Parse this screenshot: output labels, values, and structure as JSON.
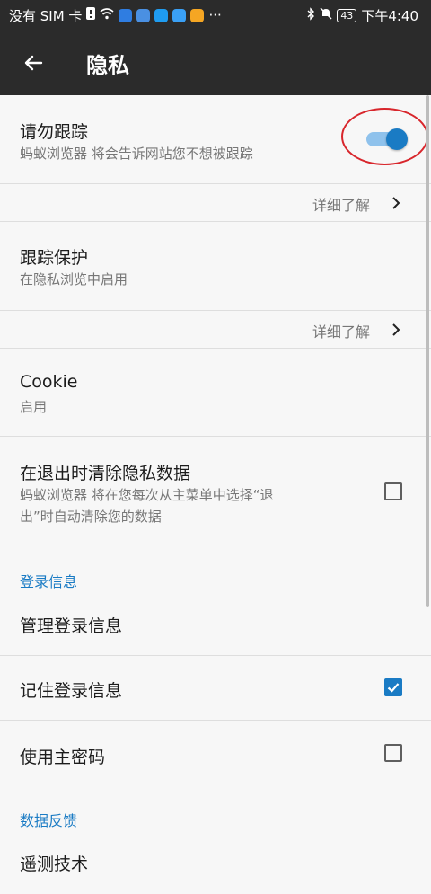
{
  "status": {
    "left_text": "没有 SIM 卡",
    "more": "···",
    "battery": "43",
    "time": "下午4:40"
  },
  "toolbar": {
    "title": "隐私"
  },
  "dnt": {
    "title": "请勿跟踪",
    "subtitle": "蚂蚁浏览器 将会告诉网站您不想被跟踪",
    "enabled": true
  },
  "learn_more_1": {
    "label": "详细了解"
  },
  "tracking": {
    "title": "跟踪保护",
    "subtitle": "在隐私浏览中启用"
  },
  "learn_more_2": {
    "label": "详细了解"
  },
  "cookie": {
    "title": "Cookie",
    "subtitle": "启用"
  },
  "clear_on_exit": {
    "title": "在退出时清除隐私数据",
    "subtitle_line1": "蚂蚁浏览器 将在您每次从主菜单中选择“退",
    "subtitle_line2": "出”时自动清除您的数据",
    "checked": false
  },
  "logins_section": {
    "header": "登录信息"
  },
  "manage_logins": {
    "title": "管理登录信息"
  },
  "remember_logins": {
    "title": "记住登录信息",
    "checked": true
  },
  "master_password": {
    "title": "使用主密码",
    "checked": false
  },
  "data_feedback_section": {
    "header": "数据反馈"
  },
  "telemetry": {
    "title": "遥测技术"
  },
  "colors": {
    "accent": "#1a7bc4",
    "toolbar": "#2b2b2b",
    "annotation": "#d8262c"
  }
}
